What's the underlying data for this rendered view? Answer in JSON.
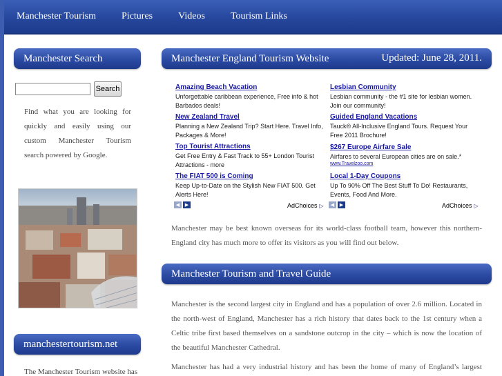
{
  "nav": {
    "items": [
      "Manchester Tourism",
      "Pictures",
      "Videos",
      "Tourism Links"
    ]
  },
  "sidebar": {
    "search_title": "Manchester Search",
    "search_button": "Search",
    "search_description": "Find what you are looking for quickly and easily using our custom Manchester Tourism search powered by Google.",
    "site_title": "manchestertourism.net",
    "site_description": "The Manchester Tourism website has"
  },
  "main": {
    "title": "Manchester England Tourism Website",
    "updated": "Updated: June 28, 2011.",
    "intro": "Manchester may be best known overseas for its world-class football team, however this northern-England city has much more to offer its visitors as you will find out below.",
    "guide_title": "Manchester Tourism and Travel Guide",
    "para1": "Manchester is the second largest city in England and has a population of over 2.6 million. Located in the north-west of England, Manchester has a rich history that dates back to the 1st century when a Celtic tribe first based themselves on a sandstone outcrop in the city – which is now the location of the beautiful Manchester Cathedral.",
    "para2": "Manchester has had a very industrial history and has been the home of many of England’s largest factories"
  },
  "ads": {
    "adchoices": "AdChoices",
    "left": [
      {
        "title": "Amazing Beach Vacation",
        "text": "Unforgettable caribbean experience, Free info & hot Barbados deals!"
      },
      {
        "title": "New Zealand Travel",
        "text": "Planning a New Zealand Trip? Start Here. Travel Info, Packages & More!"
      },
      {
        "title": "Top Tourist Attractions",
        "text": "Get Free Entry & Fast Track to 55+ London Tourist Attractions - more"
      },
      {
        "title": "The FIAT 500 is Coming",
        "text": "Keep Up-to-Date on the Stylish New FIAT 500. Get Alerts Here!"
      }
    ],
    "right": [
      {
        "title": "Lesbian Community",
        "text": "Lesbian community - the #1 site for lesbian women. Join our community!"
      },
      {
        "title": "Guided England Vacations",
        "text": "Tauck® All-Inclusive England Tours. Request Your Free 2011 Brochure!"
      },
      {
        "title": "$267 Europe Airfare Sale",
        "text": "Airfares to several European cities are on sale.*",
        "url": "www.Travelzoo.com"
      },
      {
        "title": "Local 1-Day Coupons",
        "text": "Up To 90% Off The Best Stuff To Do! Restaurants, Events, Food And More."
      }
    ]
  },
  "colors": {
    "header_blue": "#2b4aa2",
    "background_blue": "#5872c4",
    "link_blue": "#1a1aa6"
  }
}
